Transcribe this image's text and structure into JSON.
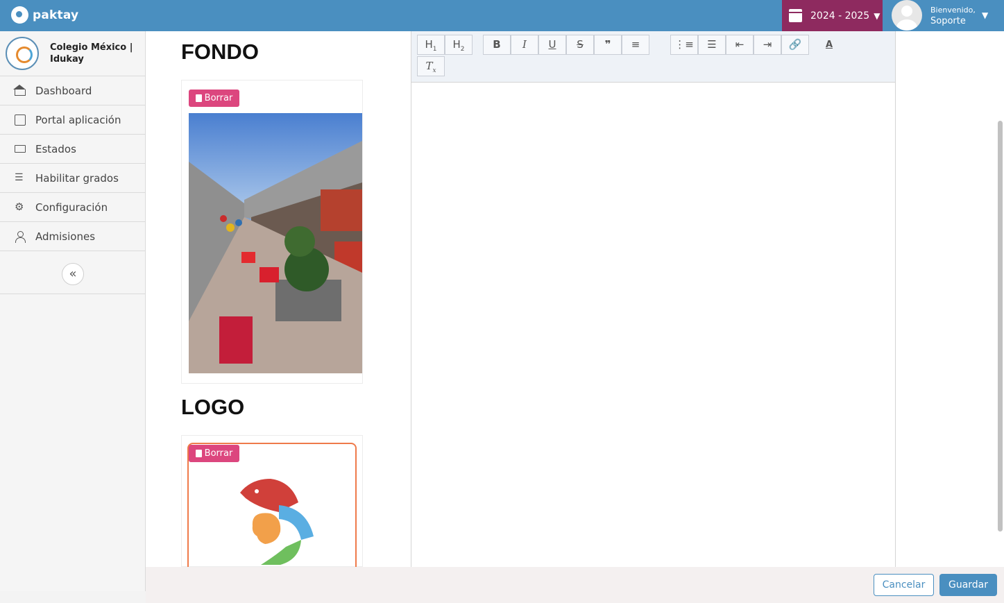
{
  "brand": {
    "name": "paktay"
  },
  "header": {
    "year": "2024 - 2025",
    "greeting": "Bienvenido,",
    "user_name": "Soporte"
  },
  "sidebar": {
    "school_name": "Colegio México | Idukay",
    "items": [
      {
        "label": "Dashboard",
        "icon": "home-icon"
      },
      {
        "label": "Portal aplicación",
        "icon": "edit-icon"
      },
      {
        "label": "Estados",
        "icon": "folder-icon"
      },
      {
        "label": "Habilitar grados",
        "icon": "list-icon"
      },
      {
        "label": "Configuración",
        "icon": "gear-icon"
      },
      {
        "label": "Admisiones",
        "icon": "user-icon"
      }
    ]
  },
  "main": {
    "fondo_title": "FONDO",
    "logo_title": "LOGO",
    "delete_label": "Borrar"
  },
  "editor": {
    "toolbar": [
      "H1",
      "H2",
      "B",
      "I",
      "U",
      "S",
      "quote",
      "align",
      "ordered-list",
      "bullet-list",
      "outdent",
      "indent",
      "link",
      "text-color",
      "clear-format"
    ]
  },
  "footer": {
    "cancel_label": "Cancelar",
    "save_label": "Guardar"
  },
  "colors": {
    "primary": "#4a8fc0",
    "year_bg": "#8e2a5f",
    "delete": "#dc467e",
    "highlight": "#ef7a4a"
  }
}
